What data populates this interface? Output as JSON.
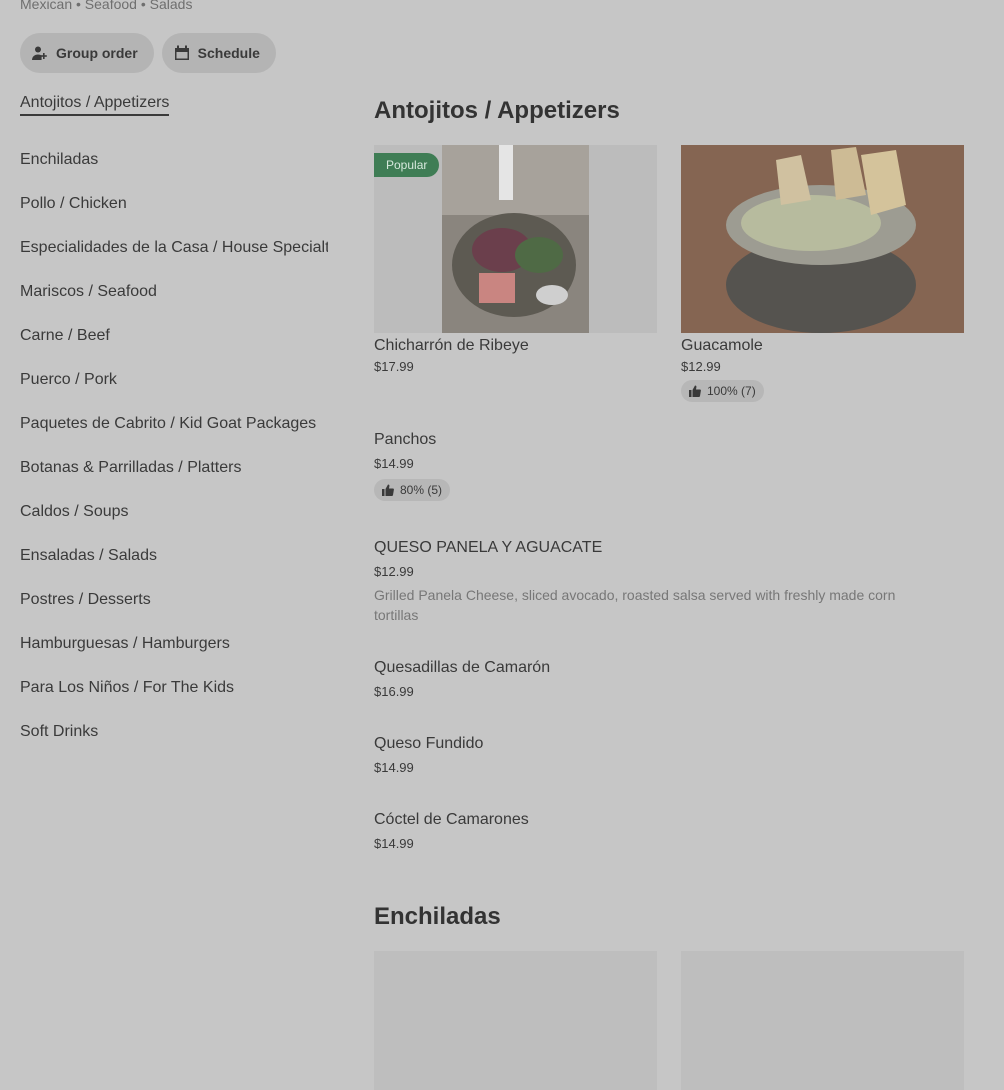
{
  "header": {
    "cuisine": "Mexican • Seafood • Salads",
    "group_order": "Group order",
    "schedule": "Schedule"
  },
  "sidebar": {
    "items": [
      {
        "label": "Antojitos / Appetizers"
      },
      {
        "label": "Enchiladas"
      },
      {
        "label": "Pollo / Chicken"
      },
      {
        "label": "Especialidades de la Casa / House Specialties"
      },
      {
        "label": "Mariscos / Seafood"
      },
      {
        "label": "Carne / Beef"
      },
      {
        "label": "Puerco / Pork"
      },
      {
        "label": "Paquetes de Cabrito / Kid Goat Packages"
      },
      {
        "label": "Botanas & Parrilladas / Platters"
      },
      {
        "label": "Caldos / Soups"
      },
      {
        "label": "Ensaladas / Salads"
      },
      {
        "label": "Postres / Desserts"
      },
      {
        "label": "Hamburguesas / Hamburgers"
      },
      {
        "label": "Para Los Niños / For The Kids"
      },
      {
        "label": "Soft Drinks"
      }
    ]
  },
  "sections": {
    "appetizers_title": "Antojitos / Appetizers",
    "enchiladas_title": "Enchiladas"
  },
  "cards": [
    {
      "name": "Chicharrón de Ribeye",
      "price": "$17.99",
      "badge": "Popular"
    },
    {
      "name": "Guacamole",
      "price": "$12.99",
      "rating": "100% (7)"
    }
  ],
  "list_items": [
    {
      "name": "Panchos",
      "price": "$14.99",
      "rating": "80% (5)"
    },
    {
      "name": "QUESO PANELA Y AGUACATE",
      "price": "$12.99",
      "description": "Grilled Panela Cheese, sliced avocado, roasted salsa served with freshly made corn tortillas"
    },
    {
      "name": "Quesadillas de Camarón",
      "price": "$16.99"
    },
    {
      "name": "Queso Fundido",
      "price": "$14.99"
    },
    {
      "name": "Cóctel de Camarones",
      "price": "$14.99"
    }
  ],
  "colors": {
    "background": "#c6c6c6",
    "badge": "#3f7d55",
    "text": "#3a3a3a"
  }
}
